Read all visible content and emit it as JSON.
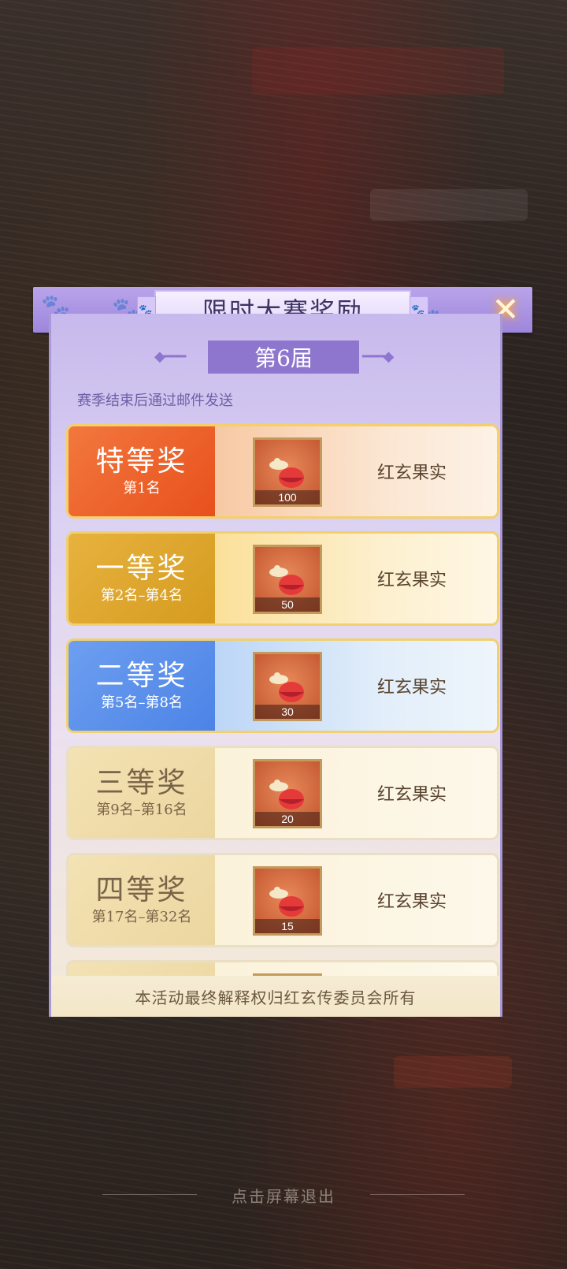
{
  "dialog": {
    "title": "限时大赛奖励",
    "close_glyph": "✕",
    "season": "第6届",
    "mail_note": "赛季结束后通过邮件发送",
    "footer_note": "本活动最终解释权归红玄传委员会所有"
  },
  "rewards": [
    {
      "tier": "特等奖",
      "rank": "第1名",
      "item_name": "红玄果实",
      "count": "100"
    },
    {
      "tier": "一等奖",
      "rank": "第2名–第4名",
      "item_name": "红玄果实",
      "count": "50"
    },
    {
      "tier": "二等奖",
      "rank": "第5名–第8名",
      "item_name": "红玄果实",
      "count": "30"
    },
    {
      "tier": "三等奖",
      "rank": "第9名–第16名",
      "item_name": "红玄果实",
      "count": "20"
    },
    {
      "tier": "四等奖",
      "rank": "第17名–第32名",
      "item_name": "红玄果实",
      "count": "15"
    }
  ],
  "exit_hint": "点击屏幕退出",
  "icons": {
    "paw": "paw-icon",
    "close": "close-icon",
    "item": "red-fruit-icon"
  },
  "colors": {
    "header": "#a58ee0",
    "tier1": "#e8501c",
    "tier2": "#d59b1f",
    "tier3": "#4c83e6",
    "tier_low": "#ecd6a0"
  }
}
